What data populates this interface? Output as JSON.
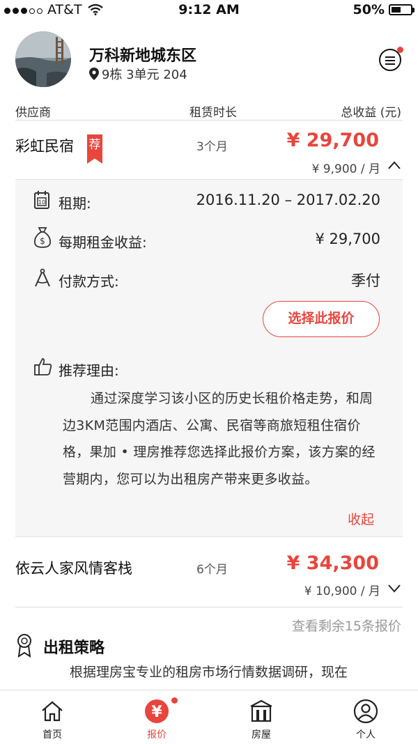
{
  "status_bar": {
    "carrier": "AT&T",
    "time": "9:12 AM",
    "battery": "50%",
    "battery_level": 0.5
  },
  "header": {
    "community": "万科新地城东区",
    "address": "9栋 3单元 204"
  },
  "table_header": {
    "supplier": "供应商",
    "duration": "租赁时长",
    "total": "总收益 (元)"
  },
  "quotes": [
    {
      "name": "彩虹民宿",
      "badge": "荐",
      "duration": "3个月",
      "total": "¥ 29,700",
      "monthly": "¥ 9,900 / 月",
      "expanded": true
    },
    {
      "name": "依云人家风情客栈",
      "duration": "6个月",
      "total": "¥ 34,300",
      "monthly": "¥ 10,900 / 月",
      "expanded": false
    }
  ],
  "detail": {
    "period_label": "租期:",
    "period_value": "2016.11.20 – 2017.02.20",
    "income_label": "每期租金收益:",
    "income_value": "¥ 29,700",
    "payment_label": "付款方式:",
    "payment_value": "季付",
    "select_button": "选择此报价",
    "reason_label": "推荐理由:",
    "reason_text": "通过深度学习该小区的历史长租价格走势，和周边3KM范围内酒店、公寓、民宿等商旅短租住宿价格，果加 • 理房推荐您选择此报价方案，该方案的经营期内，您可以为出租房产带来更多收益。",
    "collapse": "收起"
  },
  "more_quotes": "查看剩余15条报价",
  "strategy": {
    "title": "出租策略",
    "text": "根据理房宝专业的租房市场行情数据调研，现在"
  },
  "tabs": [
    {
      "label": "首页",
      "icon": "home-icon"
    },
    {
      "label": "报价",
      "icon": "yen-icon",
      "active": true
    },
    {
      "label": "房屋",
      "icon": "building-icon"
    },
    {
      "label": "个人",
      "icon": "person-icon"
    }
  ],
  "colors": {
    "accent": "#e8453c",
    "panel_bg": "#f6f6f6"
  }
}
